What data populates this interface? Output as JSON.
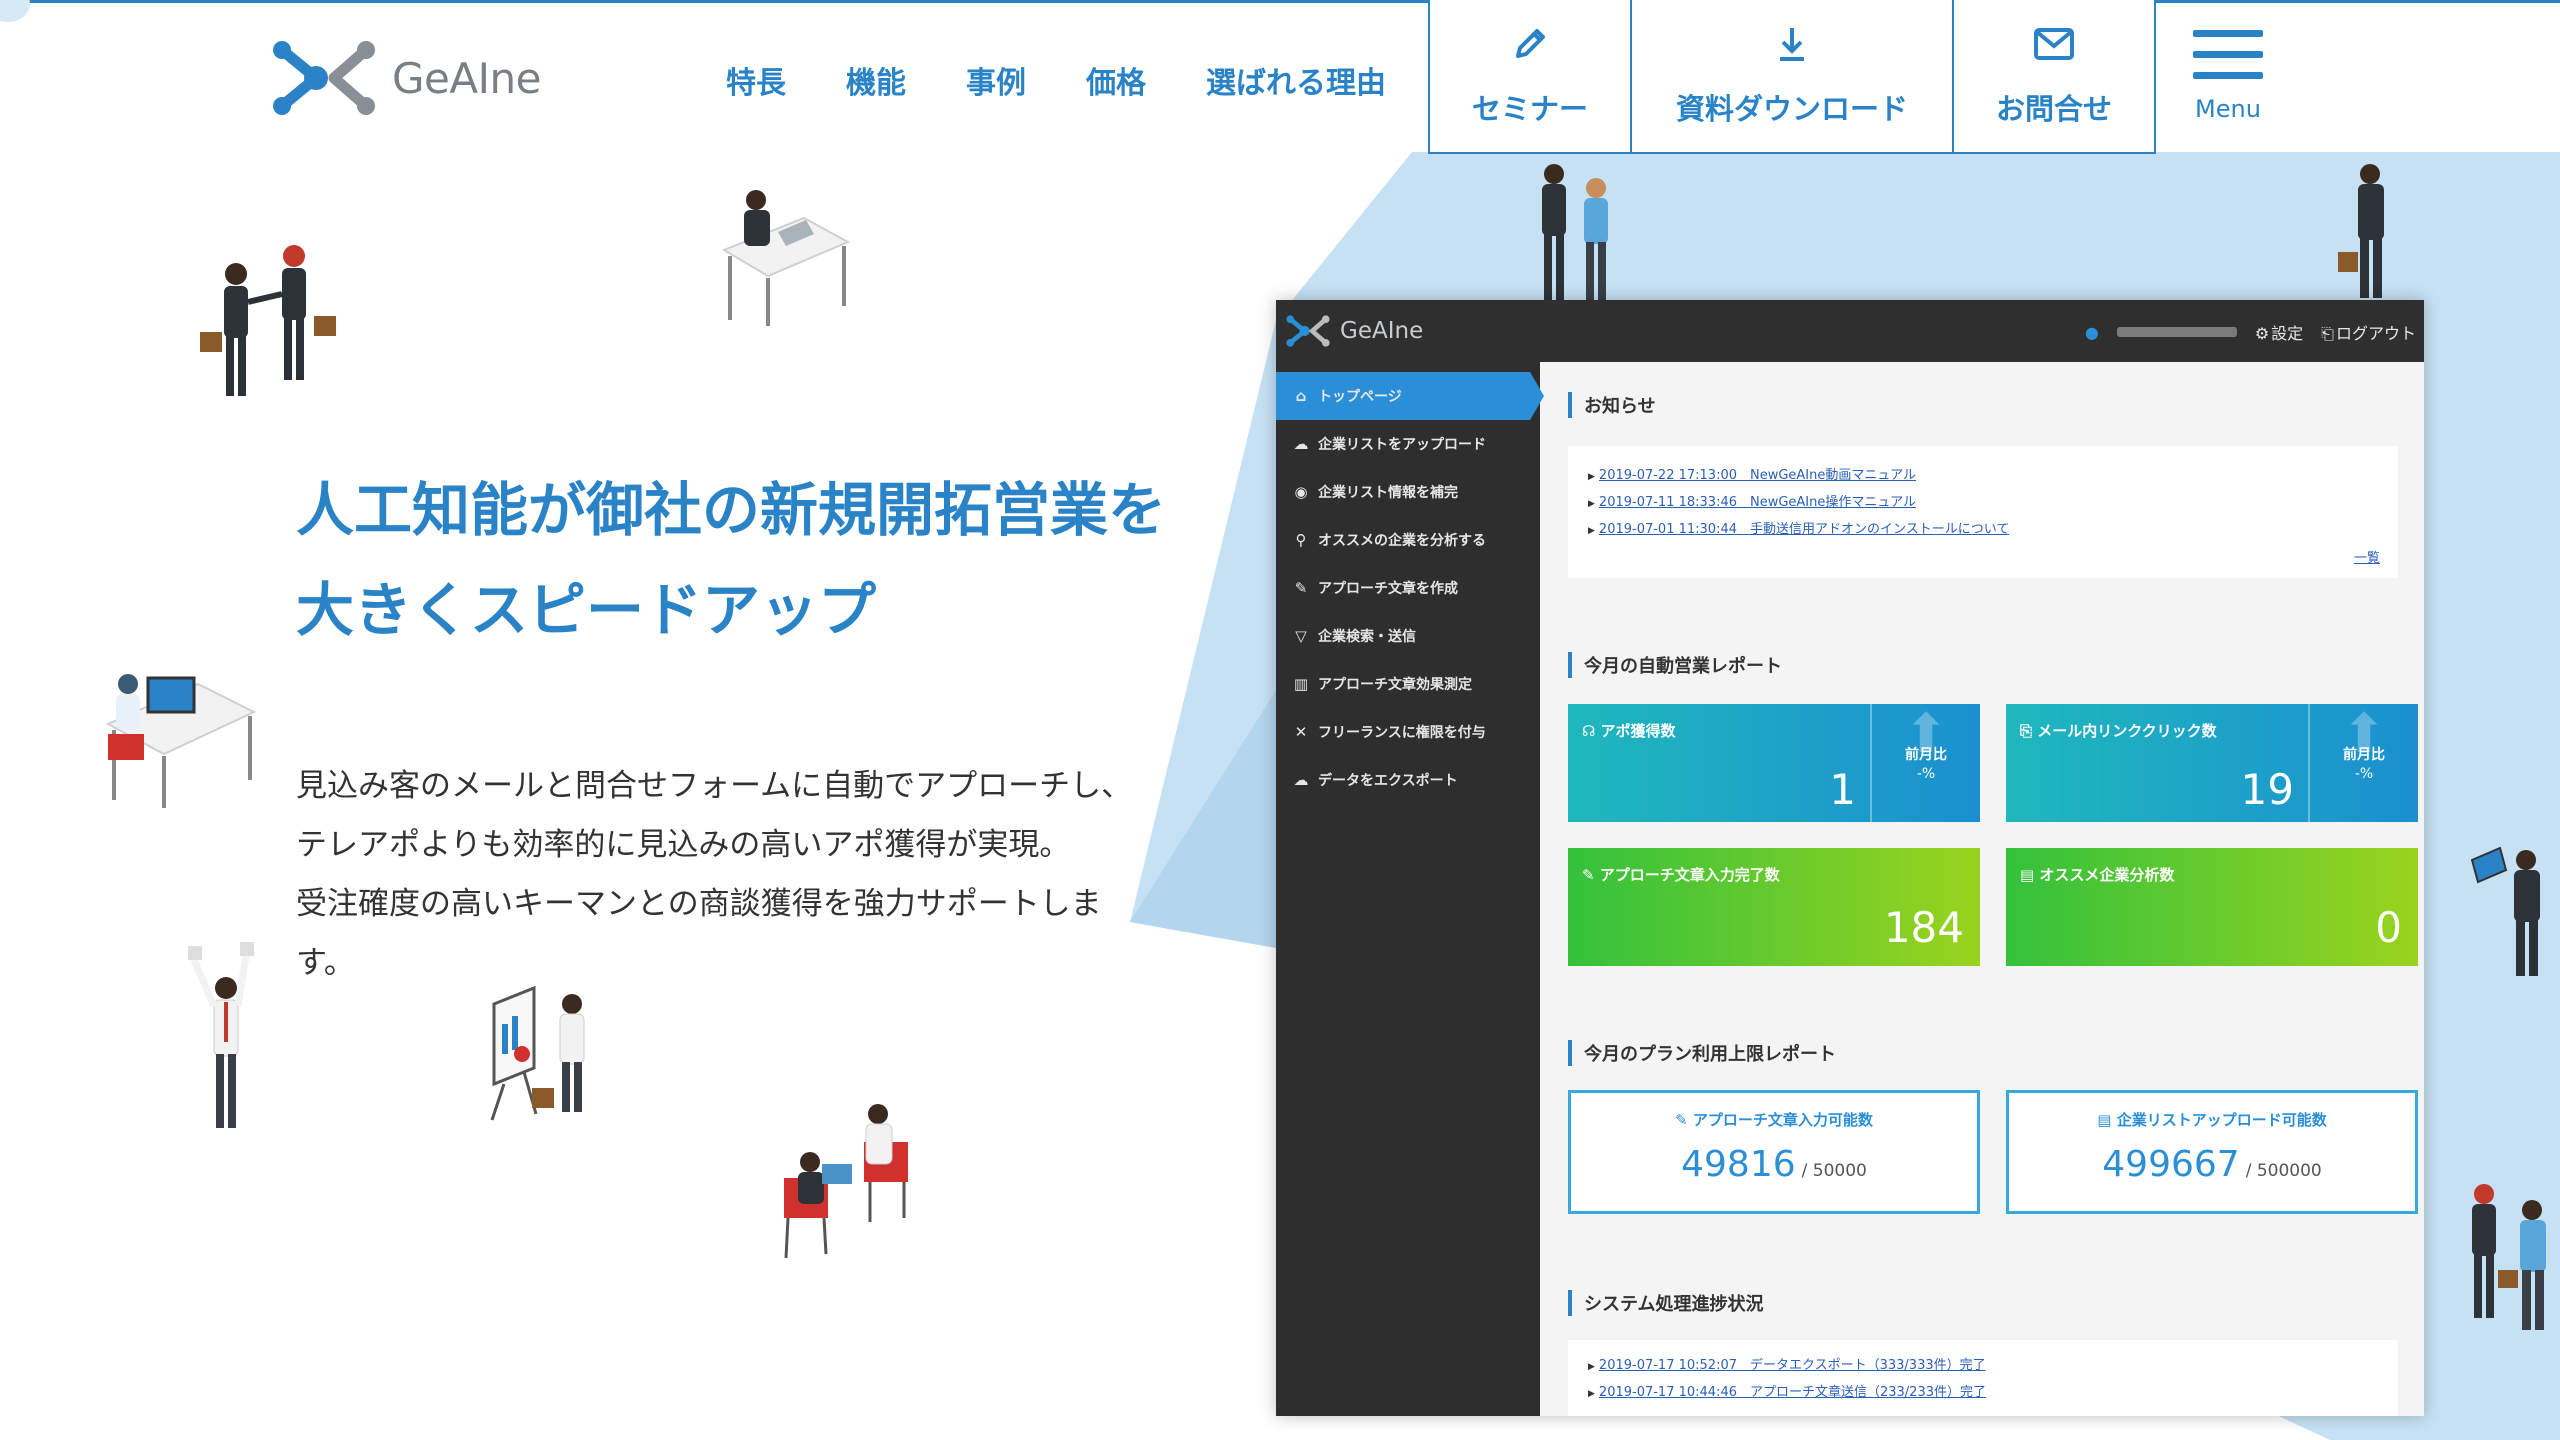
{
  "header": {
    "logo_text": "GeAIne",
    "nav": [
      "特長",
      "機能",
      "事例",
      "価格",
      "選ばれる理由"
    ],
    "cta": {
      "seminar": "セミナー",
      "download": "資料ダウンロード",
      "contact": "お問合せ"
    },
    "menu_label": "Menu"
  },
  "hero": {
    "headline_line1": "人工知能が御社の新規開拓営業を",
    "headline_line2": "大きくスピードアップ",
    "lead_line1": "見込み客のメールと問合せフォームに自動でアプローチし、",
    "lead_line2": "テレアポよりも効率的に見込みの高いアポ獲得が実現。",
    "lead_line3": "受注確度の高いキーマンとの商談獲得を強力サポートしま",
    "lead_line4": "す。"
  },
  "app": {
    "logo_text": "GeAIne",
    "user_settings": "設定",
    "logout": "ログアウト",
    "sidebar": [
      "トップページ",
      "企業リストをアップロード",
      "企業リスト情報を補完",
      "オススメの企業を分析する",
      "アプローチ文章を作成",
      "企業検索・送信",
      "アプローチ文章効果測定",
      "フリーランスに権限を付与",
      "データをエクスポート"
    ],
    "news_title": "お知らせ",
    "news": [
      "2019-07-22 17:13:00　NewGeAIne動画マニュアル",
      "2019-07-11 18:33:46　NewGeAIne操作マニュアル",
      "2019-07-01 11:30:44　手動送信用アドオンのインストールについて"
    ],
    "news_more": "一覧",
    "report_title": "今月の自動営業レポート",
    "stats": [
      {
        "label": "アポ獲得数",
        "value": "1",
        "compare": "前月比",
        "pct": "-%"
      },
      {
        "label": "メール内リンククリック数",
        "value": "19",
        "compare": "前月比",
        "pct": "-%"
      },
      {
        "label": "アプローチ文章入力完了数",
        "value": "184"
      },
      {
        "label": "オススメ企業分析数",
        "value": "0"
      }
    ],
    "plan_title": "今月のプラン利用上限レポート",
    "plans": [
      {
        "label": "アプローチ文章入力可能数",
        "value": "49816",
        "limit": "/ 50000"
      },
      {
        "label": "企業リストアップロード可能数",
        "value": "499667",
        "limit": "/ 500000"
      }
    ],
    "process_title": "システム処理進捗状況",
    "process": [
      "2019-07-17 10:52:07　データエクスポート（333/333件）完了",
      "2019-07-17 10:44:46　アプローチ文章送信（233/233件）完了"
    ]
  },
  "colors": {
    "brand": "#2a83c6",
    "light_blue": "#c5e0f3",
    "dark_panel": "#2e2e2e",
    "teal_card": "#1fb8bd",
    "green_card": "#34c13d"
  }
}
